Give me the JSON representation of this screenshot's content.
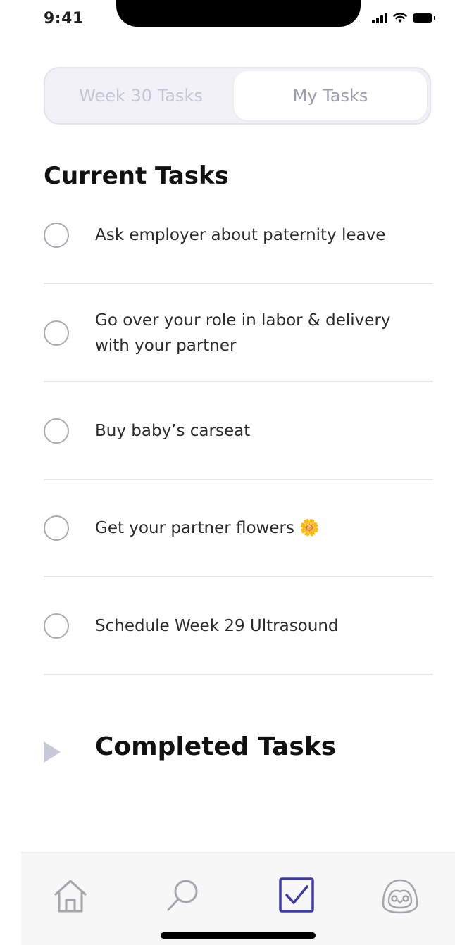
{
  "status": {
    "time": "9:41"
  },
  "segment": {
    "left_tab": "Week 30 Tasks",
    "right_tab": "My Tasks"
  },
  "current": {
    "title": "Current Tasks",
    "tasks": [
      {
        "label": "Ask employer about paternity leave"
      },
      {
        "label": "Go over your role in labor & delivery with your partner"
      },
      {
        "label": "Buy baby’s carseat"
      },
      {
        "label": "Get your partner flowers 🌼"
      },
      {
        "label": "Schedule Week 29 Ultrasound"
      }
    ]
  },
  "completed": {
    "title": "Completed Tasks"
  },
  "tabbar": {
    "items": [
      {
        "icon": "home-icon"
      },
      {
        "icon": "search-icon"
      },
      {
        "icon": "tasks-icon"
      },
      {
        "icon": "penguin-profile-icon"
      }
    ],
    "active_color": "#3f3aa8",
    "inactive_color": "#a5a5ac"
  }
}
